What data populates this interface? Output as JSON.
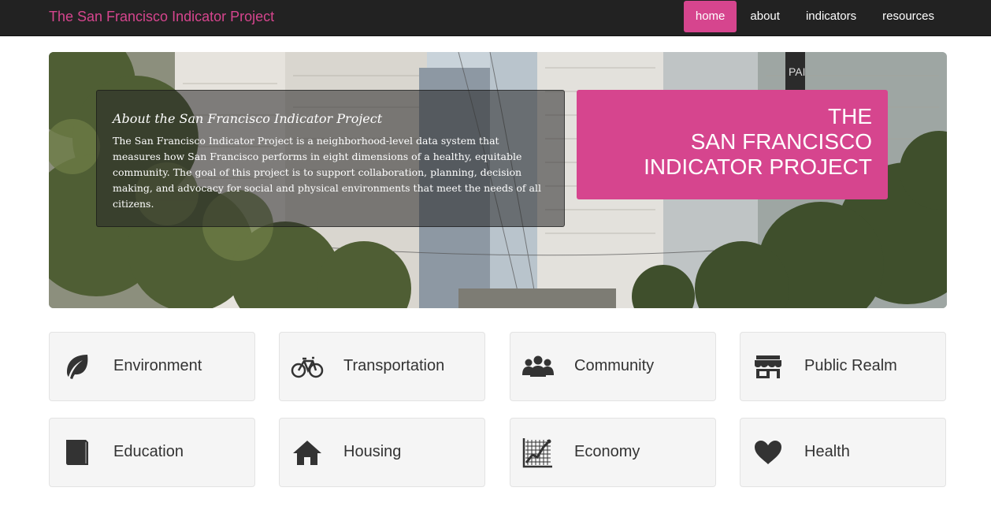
{
  "navbar": {
    "brand": "The San Francisco Indicator Project",
    "items": [
      {
        "label": "home",
        "active": true
      },
      {
        "label": "about",
        "active": false
      },
      {
        "label": "indicators",
        "active": false
      },
      {
        "label": "resources",
        "active": false
      }
    ]
  },
  "hero": {
    "about_title": "About the San Francisco Indicator Project",
    "about_text": "The San Francisco Indicator Project is a neighborhood-level data system that measures how San Francisco performs in eight dimensions of a healthy, equitable community. The goal of this project is to support collaboration, planning, decision making, and advocacy for social and physical environments that meet the needs of all citizens.",
    "title_lines": [
      "THE",
      "SAN FRANCISCO",
      "INDICATOR PROJECT"
    ],
    "sign_text": "PAI"
  },
  "categories": [
    {
      "label": "Environment",
      "icon": "leaf-icon"
    },
    {
      "label": "Transportation",
      "icon": "bicycle-icon"
    },
    {
      "label": "Community",
      "icon": "people-icon"
    },
    {
      "label": "Public Realm",
      "icon": "storefront-icon"
    },
    {
      "label": "Education",
      "icon": "book-icon"
    },
    {
      "label": "Housing",
      "icon": "house-icon"
    },
    {
      "label": "Economy",
      "icon": "line-chart-icon"
    },
    {
      "label": "Health",
      "icon": "heart-icon"
    }
  ],
  "colors": {
    "accent": "#d6458e",
    "navbar": "#222222",
    "tile_bg": "#f5f5f5",
    "text": "#333333"
  }
}
